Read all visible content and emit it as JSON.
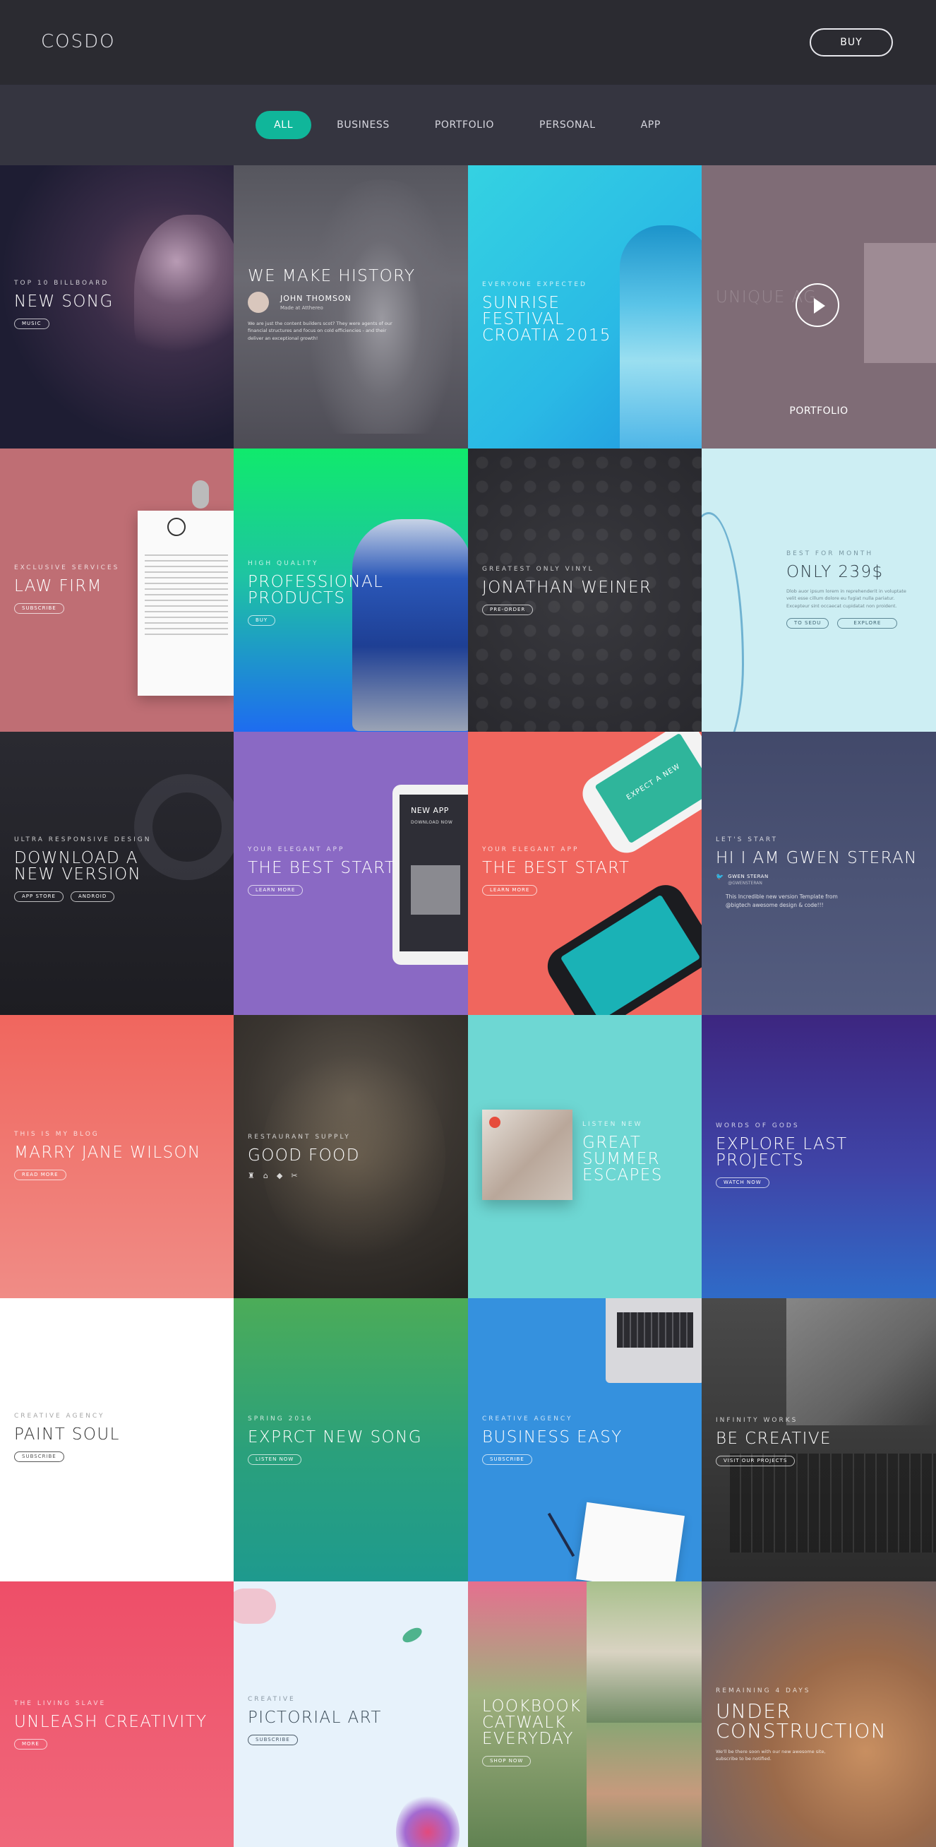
{
  "header": {
    "logo": "COSDO",
    "buy_label": "BUY"
  },
  "filters": [
    {
      "label": "ALL",
      "active": true
    },
    {
      "label": "BUSINESS",
      "active": false
    },
    {
      "label": "PORTFOLIO",
      "active": false
    },
    {
      "label": "PERSONAL",
      "active": false
    },
    {
      "label": "APP",
      "active": false
    }
  ],
  "tiles": [
    {
      "kicker": "TOP 10 BILLBOARD",
      "title": "NEW SONG",
      "button": "MUSIC"
    },
    {
      "title": "WE MAKE HISTORY",
      "author": "JOHN THOMSON",
      "author_role": "Made at Atthereo",
      "text": "We are just the content builders scot? They were agents of our financial structures and focus on cold efficiencies - and their deliver an exceptional growth!"
    },
    {
      "kicker": "EVERYONE EXPECTED",
      "title": "SUNRISE FESTIVAL CROATIA 2015"
    },
    {
      "title": "UNIQUE AG",
      "label": "PORTFOLIO"
    },
    {
      "kicker": "EXCLUSIVE SERVICES",
      "title": "LAW FIRM",
      "button": "SUBSCRIBE"
    },
    {
      "kicker": "HIGH QUALITY",
      "title": "PROFESSIONAL PRODUCTS",
      "button": "BUY"
    },
    {
      "kicker": "GREATEST ONLY VINYL",
      "title": "JONATHAN WEINER",
      "button": "PRE-ORDER"
    },
    {
      "kicker": "BEST FOR MONTH",
      "title": "ONLY 239$",
      "text": "Dlob auor ipsum lorem in reprehenderit in voluptate velit esse cillum dolore eu fugiat nulla pariatur. Excepteur sint occaecat cupidatat non proident.",
      "button1": "TO SEDU",
      "button2": "EXPLORE"
    },
    {
      "kicker": "ULTRA RESPONSIVE DESIGN",
      "title": "DOWNLOAD A NEW VERSION",
      "button1": "APP STORE",
      "button2": "ANDROID"
    },
    {
      "kicker": "YOUR ELEGANT APP",
      "title": "THE BEST START",
      "button": "LEARN MORE",
      "screen_title": "NEW APP",
      "screen_sub": "DOWNLOAD NOW"
    },
    {
      "kicker": "YOUR ELEGANT APP",
      "title": "THE BEST START",
      "button": "LEARN MORE",
      "phone_text": "EXPECT A NEW"
    },
    {
      "kicker": "LET'S START",
      "title": "HI I AM GWEN STERAN",
      "handle": "GWEN STERAN",
      "handle_sub": "@GWENSTERAN",
      "text": "This Incredible new version Template from @bigtech awesome design & code!!!"
    },
    {
      "kicker": "THIS IS MY BLOG",
      "title": "MARRY JANE WILSON",
      "button": "READ MORE"
    },
    {
      "kicker": "RESTAURANT SUPPLY",
      "title": "GOOD FOOD"
    },
    {
      "kicker": "LISTEN NEW",
      "title": "GREAT SUMMER ESCAPES"
    },
    {
      "kicker": "WORDS OF GODS",
      "title": "EXPLORE LAST PROJECTS",
      "button": "WATCH NOW"
    },
    {
      "kicker": "CREATIVE AGENCY",
      "title": "PAINT SOUL",
      "button": "SUBSCRIBE"
    },
    {
      "kicker": "SPRING 2016",
      "title": "EXPRCT NEW SONG",
      "button": "LISTEN NOW"
    },
    {
      "kicker": "CREATIVE AGENCY",
      "title": "BUSINESS EASY",
      "button": "SUBSCRIBE"
    },
    {
      "kicker": "INFINITY WORKS",
      "title": "BE CREATIVE",
      "button": "VISIT OUR PROJECTS"
    },
    {
      "kicker": "THE LIVING SLAVE",
      "title": "UNLEASH CREATIVITY",
      "button": "MORE"
    },
    {
      "kicker": "CREATIVE",
      "title": "PICTORIAL ART",
      "button": "SUBSCRIBE"
    },
    {
      "title": "LOOKBOOK CATWALK EVERYDAY",
      "button": "SHOP NOW"
    },
    {
      "kicker": "REMAINING 4 DAYS",
      "title": "UNDER CONSTRUCTION",
      "text": "We'll be there soon with our new awesome site, subscribe to be notified."
    }
  ]
}
